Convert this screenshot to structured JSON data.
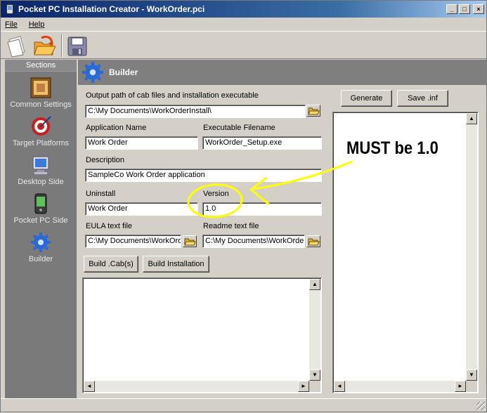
{
  "window": {
    "title": "Pocket PC Installation Creator - WorkOrder.pci",
    "min_glyph": "_",
    "max_glyph": "□",
    "close_glyph": "×"
  },
  "menu": {
    "file": "File",
    "help": "Help"
  },
  "sections": {
    "header": "Sections",
    "items": [
      {
        "label": "Common Settings",
        "icon": "common-settings-icon"
      },
      {
        "label": "Target Platforms",
        "icon": "target-icon"
      },
      {
        "label": "Desktop Side",
        "icon": "desktop-icon"
      },
      {
        "label": "Pocket PC Side",
        "icon": "pocket-pc-icon"
      },
      {
        "label": "Builder",
        "icon": "gear-icon"
      }
    ]
  },
  "builder": {
    "title": "Builder",
    "output_path_label": "Output path of cab files and installation executable",
    "output_path_value": "C:\\My Documents\\WorkOrderInstall\\",
    "app_name_label": "Application Name",
    "app_name_value": "Work Order",
    "exe_label": "Executable Filename",
    "exe_value": "WorkOrder_Setup.exe",
    "description_label": "Description",
    "description_value": "SampleCo Work Order application",
    "uninstall_label": "Uninstall",
    "uninstall_value": "Work Order",
    "version_label": "Version",
    "version_value": "1.0",
    "eula_label": "EULA text file",
    "eula_value": "C:\\My Documents\\WorkOrde",
    "readme_label": "Readme text file",
    "readme_value": "C:\\My Documents\\WorkOrder",
    "build_cabs": "Build .Cab(s)",
    "build_install": "Build Installation",
    "generate": "Generate",
    "save_inf": "Save .inf"
  },
  "annotation": {
    "text": "MUST be 1.0",
    "color": "#ffff00"
  },
  "colors": {
    "panel_gray": "#7f7f7f",
    "face": "#d4d0c8",
    "title_start": "#0a246a"
  }
}
